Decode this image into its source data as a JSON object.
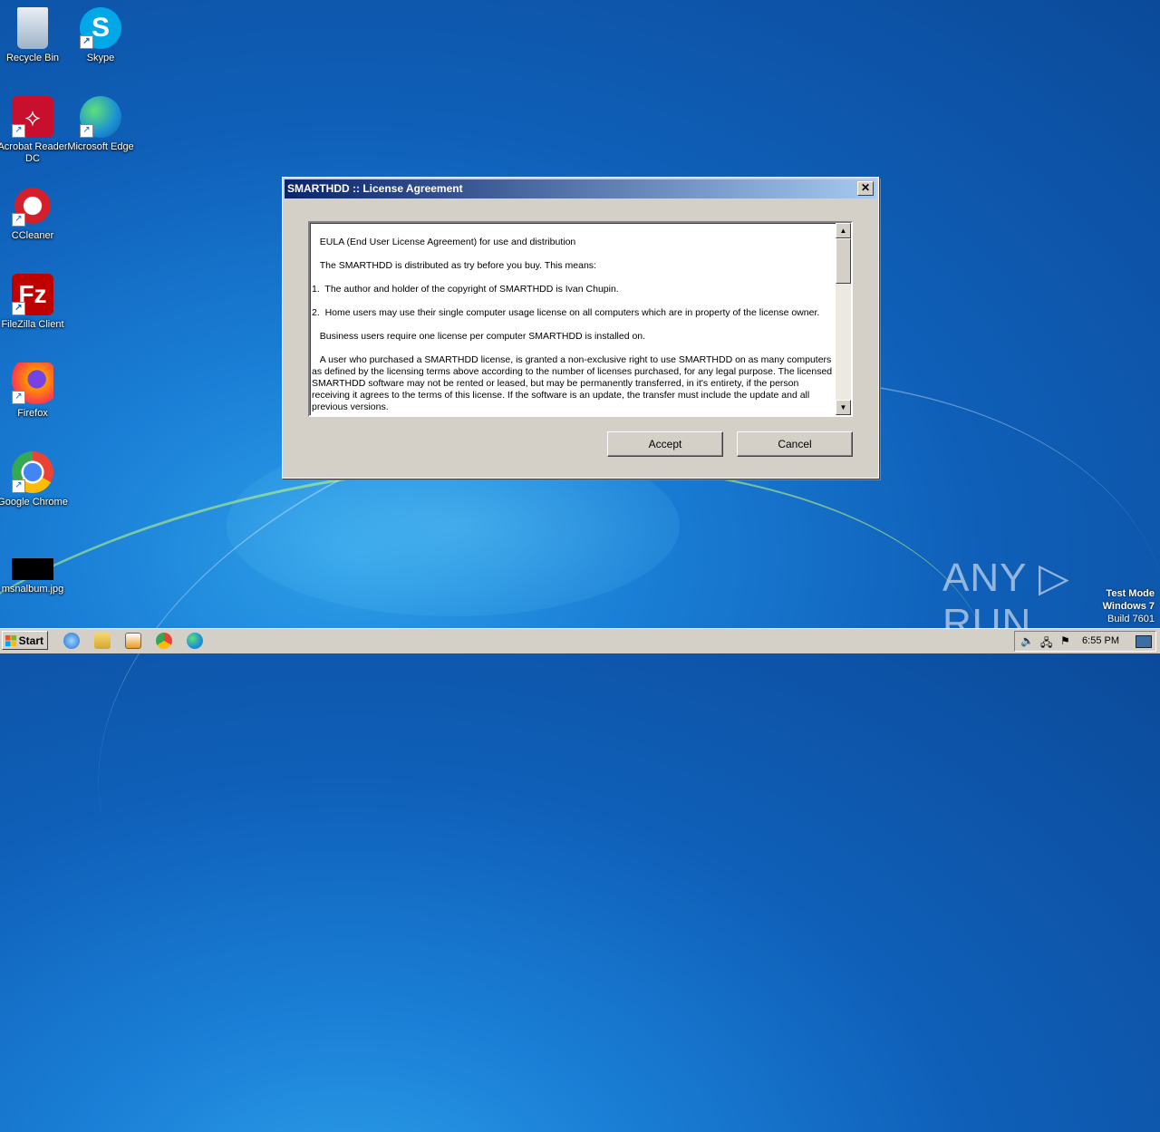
{
  "desktop": {
    "icons": [
      {
        "label": "Recycle Bin",
        "icon": "recycle-bin-icon"
      },
      {
        "label": "Skype",
        "icon": "skype-icon"
      },
      {
        "label": "Acrobat Reader DC",
        "icon": "acrobat-icon"
      },
      {
        "label": "Microsoft Edge",
        "icon": "edge-icon"
      },
      {
        "label": "CCleaner",
        "icon": "ccleaner-icon"
      },
      {
        "label": "FileZilla Client",
        "icon": "filezilla-icon"
      },
      {
        "label": "Firefox",
        "icon": "firefox-icon"
      },
      {
        "label": "Google Chrome",
        "icon": "chrome-icon"
      },
      {
        "label": "msnalbum.jpg",
        "icon": "image-file-icon"
      }
    ]
  },
  "dialog": {
    "title": "SMARTHDD :: License Agreement",
    "close_glyph": "✕",
    "license_paragraphs": [
      "   EULA (End User License Agreement) for use and distribution",
      "   The SMARTHDD is distributed as try before you buy. This means:",
      "1.  The author and holder of the copyright of SMARTHDD is Ivan Chupin.",
      "2.  Home users may use their single computer usage license on all computers which are in property of the license owner.",
      "   Business users require one license per computer SMARTHDD is installed on.",
      "   A user who purchased a SMARTHDD license, is granted a non-exclusive right to use SMARTHDD on as many computers as defined by the licensing terms above according to the number of licenses purchased, for any legal purpose. The licensed SMARTHDD software may not be rented or leased, but may be permanently transferred, in it's entirety, if the person receiving it agrees to the terms of this license. If the software is an update, the transfer must include the update and all previous versions."
    ],
    "accept_label": "Accept",
    "cancel_label": "Cancel",
    "scroll_up": "▲",
    "scroll_down": "▼"
  },
  "taskbar": {
    "start_label": "Start",
    "clock": "6:55 PM",
    "pinned": [
      "ie-icon",
      "explorer-icon",
      "media-player-icon",
      "chrome-icon",
      "edge-icon"
    ]
  },
  "watermark": {
    "line1": "Test Mode",
    "line2": "Windows 7",
    "line3": "Build 7601",
    "brand": "ANY ▷ RUN"
  },
  "colors": {
    "titlebar_start": "#0a246a",
    "titlebar_end": "#a6caf0",
    "dialog_face": "#d4d0c8"
  }
}
